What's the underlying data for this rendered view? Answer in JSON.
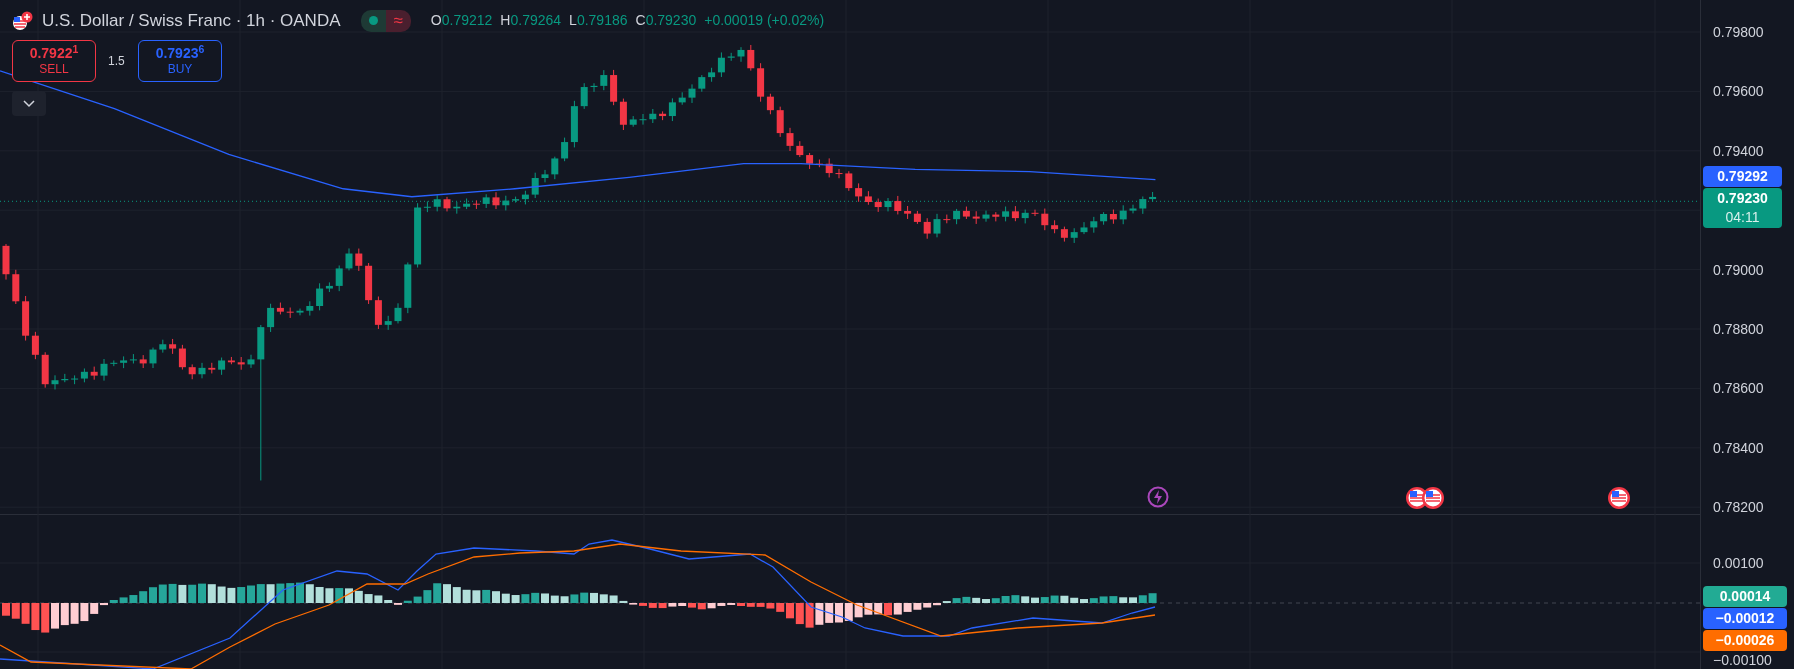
{
  "header": {
    "symbol": "U.S. Dollar / Swiss Franc · 1h · OANDA",
    "market_open": true,
    "indicator": "≈",
    "ohlc": [
      {
        "label": "O",
        "value": "0.79212"
      },
      {
        "label": "H",
        "value": "0.79264"
      },
      {
        "label": "L",
        "value": "0.79186"
      },
      {
        "label": "C",
        "value": "0.79230"
      }
    ],
    "change": "+0.00019 (+0.02%)"
  },
  "trade": {
    "sell": {
      "price": "0.7922$^{1}$",
      "label": "SELL"
    },
    "spread": "1.5",
    "buy": {
      "price": "0.7923$^{6}$",
      "label": "BUY"
    }
  },
  "price_axis": {
    "labels": [
      "0.79800",
      "0.79600",
      "0.79400",
      "0.79000",
      "0.78800",
      "0.78600",
      "0.78400",
      "0.78200"
    ]
  },
  "price_badges": [
    {
      "kind": "ma",
      "value": "0.79292",
      "color": "#2962ff"
    },
    {
      "kind": "last",
      "value": "0.79230",
      "countdown": "04:11",
      "color": "#089981"
    }
  ],
  "macd_axis": {
    "labels": [
      "0.00100",
      "−0.00100"
    ]
  },
  "macd_badges": [
    {
      "value": "0.00014",
      "color": "#22ab94"
    },
    {
      "value": "−0.00012",
      "color": "#2962ff"
    },
    {
      "value": "−0.00026",
      "color": "#ff6d00"
    }
  ],
  "events": [
    {
      "kind": "lightning"
    },
    {
      "kind": "flag"
    },
    {
      "kind": "flag"
    },
    {
      "kind": "flag"
    }
  ]
}
